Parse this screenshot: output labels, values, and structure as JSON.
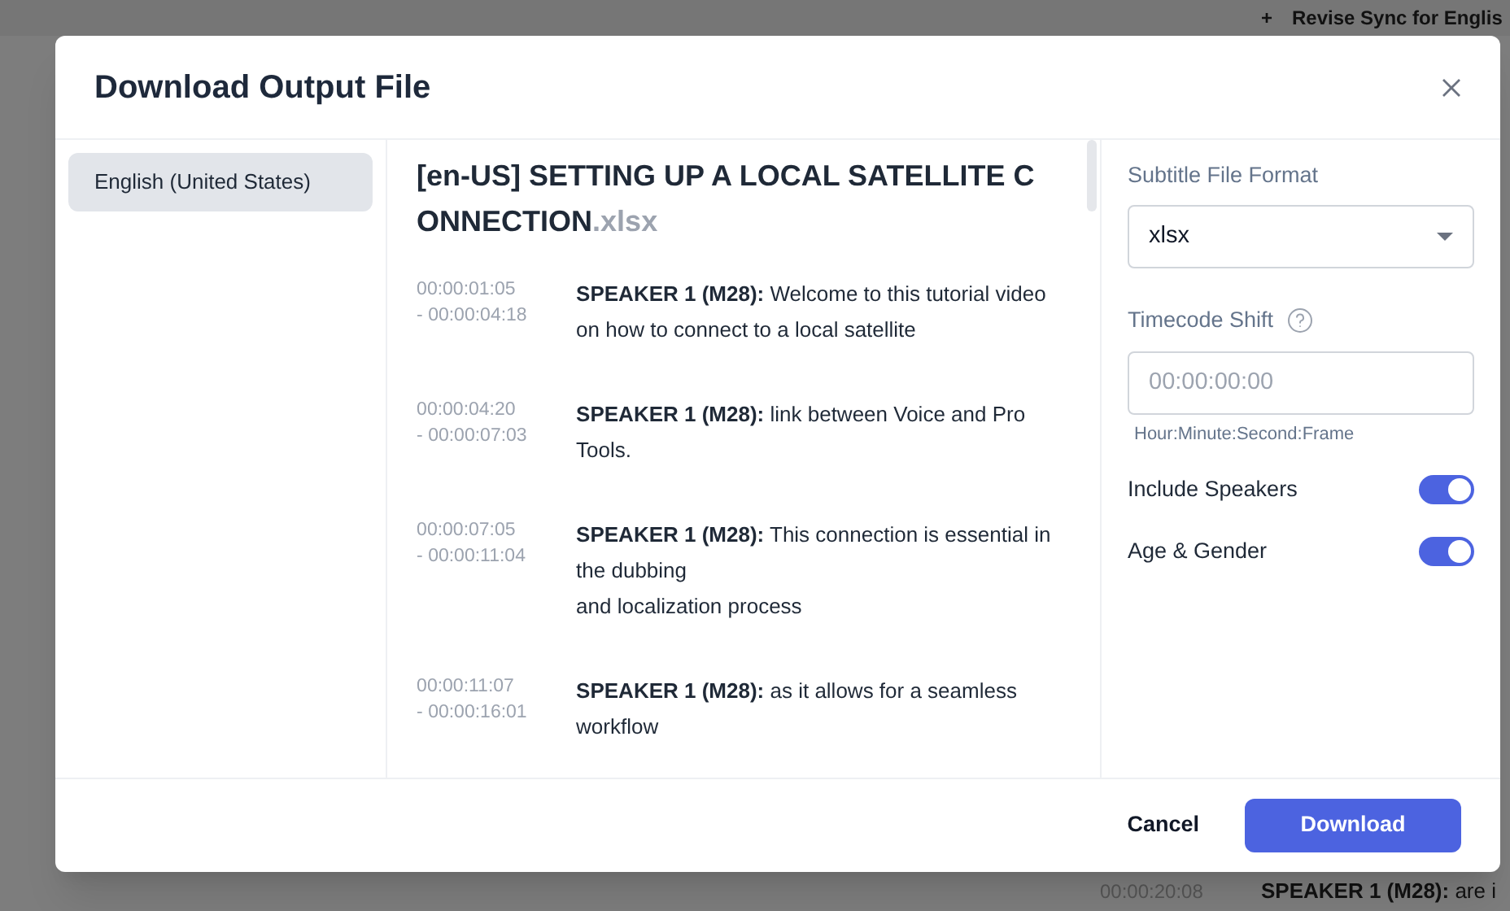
{
  "background": {
    "top_action": "+",
    "top_label": "Revise Sync for Englis",
    "bottom_time": "00:00:20:08",
    "bottom_text": "**SPEAKER 1 (M28):** are i"
  },
  "dialog": {
    "title": "Download Output File",
    "languages": [
      {
        "label": "English (United States)",
        "selected": true
      }
    ],
    "file": {
      "name": "[en-US] SETTING UP A LOCAL SATELLITE CONNECTION",
      "extension": ".xlsx"
    },
    "cues": [
      {
        "start": "00:00:01:05",
        "end": "- 00:00:04:18",
        "lines": [
          "**SPEAKER 1 (M28):** Welcome to this tutorial video on how to connect to a local satellite"
        ]
      },
      {
        "start": "00:00:04:20",
        "end": "- 00:00:07:03",
        "lines": [
          "**SPEAKER 1 (M28):** link between Voice and Pro Tools."
        ]
      },
      {
        "start": "00:00:07:05",
        "end": "- 00:00:11:04",
        "lines": [
          "**SPEAKER 1 (M28):** This connection is essential in the dubbing",
          "and localization process"
        ]
      },
      {
        "start": "00:00:11:07",
        "end": "- 00:00:16:01",
        "lines": [
          "**SPEAKER 1 (M28):** as it allows for a seamless workflow"
        ]
      }
    ],
    "format": {
      "label": "Subtitle File Format",
      "value": "xlsx"
    },
    "timecode": {
      "label": "Timecode Shift",
      "placeholder": "00:00:00:00",
      "hint": "Hour:Minute:Second:Frame"
    },
    "toggles": [
      {
        "label": "Include Speakers",
        "on": true
      },
      {
        "label": "Age & Gender",
        "on": true
      }
    ],
    "buttons": {
      "cancel": "Cancel",
      "download": "Download"
    }
  }
}
